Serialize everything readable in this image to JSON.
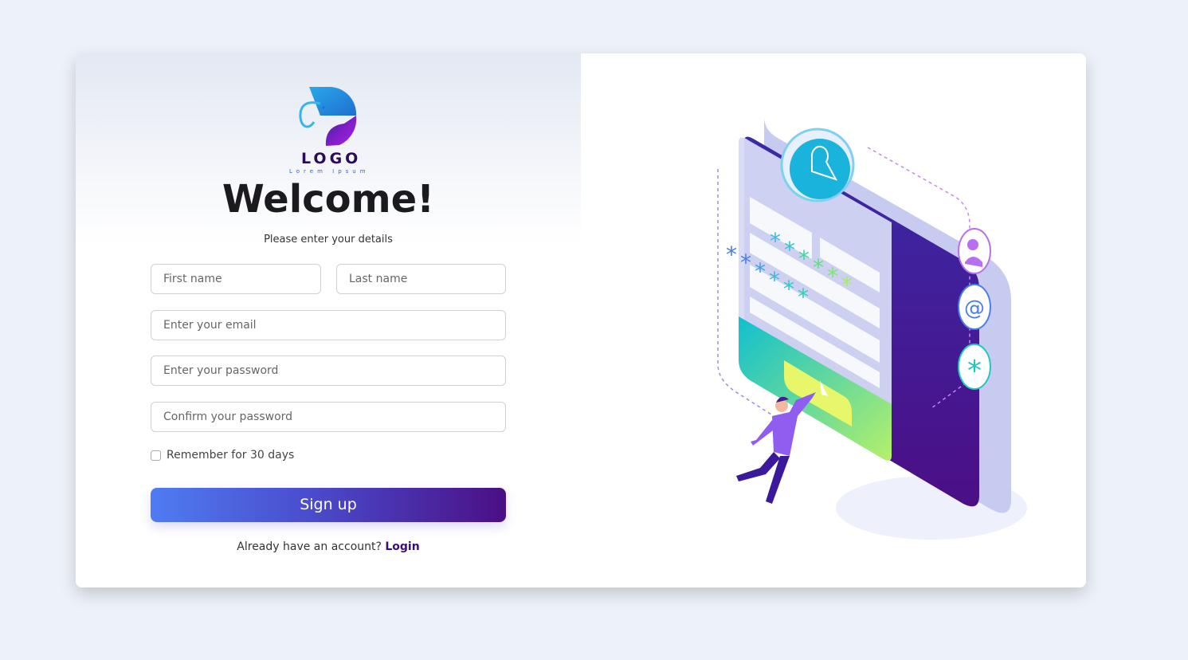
{
  "logo": {
    "text": "LOGO",
    "tagline": "Lorem Ipsum"
  },
  "title": "Welcome!",
  "subtitle": "Please enter your details",
  "form": {
    "first_name_placeholder": "First name",
    "last_name_placeholder": "Last name",
    "email_placeholder": "Enter your email",
    "password_placeholder": "Enter your password",
    "confirm_placeholder": "Confirm your password",
    "remember_label": "Remember for 30 days",
    "remember_checked": false,
    "signup_label": "Sign up"
  },
  "footer": {
    "prompt": "Already have an account?",
    "login_label": "Login"
  },
  "colors": {
    "background": "#edf1f9",
    "button_start": "#4f7cf2",
    "button_end": "#4b0f85",
    "login_link": "#3a0d7a"
  }
}
